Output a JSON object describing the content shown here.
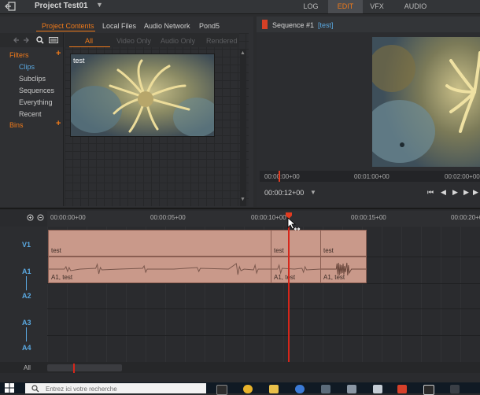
{
  "app": {
    "project_title": "Project Test01",
    "caret": "▼",
    "tabs": [
      {
        "label": "LOG"
      },
      {
        "label": "EDIT"
      },
      {
        "label": "VFX"
      },
      {
        "label": "AUDIO"
      }
    ],
    "active_tab": "EDIT"
  },
  "browser": {
    "tabs": [
      "Project Contents",
      "Local Files",
      "Audio Network",
      "Pond5"
    ],
    "filters_label": "Filters",
    "filters": [
      "Clips",
      "Subclips",
      "Sequences",
      "Everything",
      "Recent"
    ],
    "bins_label": "Bins",
    "add_symbol": "+",
    "filter_tabs": [
      "All",
      "Video Only",
      "Audio Only",
      "Rendered"
    ],
    "clip_name": "test"
  },
  "sequence": {
    "label": "Sequence #1",
    "name": "[test]",
    "ruler_timecodes": [
      "00:00:00+00",
      "00:01:00+00",
      "00:02:00+00"
    ],
    "current_timecode": "00:00:12+00",
    "transport": [
      "⏮",
      "◀",
      "▶",
      "▶",
      "▶"
    ]
  },
  "timeline": {
    "ruler_timecodes": [
      "00:00:00+00",
      "00:00:05+00",
      "00:00:10+00",
      "00:00:15+00",
      "00:00:20+00"
    ],
    "tracks": [
      "V1",
      "A1",
      "A2",
      "A3",
      "A4"
    ],
    "video_clips": [
      "test",
      "test",
      "test"
    ],
    "audio_clips": [
      "A1, test",
      "A1, test",
      "A1, test"
    ],
    "footer_label": "All"
  },
  "taskbar": {
    "search_placeholder": "Entrez ici votre recherche"
  },
  "colors": {
    "accent": "#f07a1a",
    "track_label": "#5aa8e0",
    "clip": "#c9998a",
    "playhead": "#d6261a"
  }
}
